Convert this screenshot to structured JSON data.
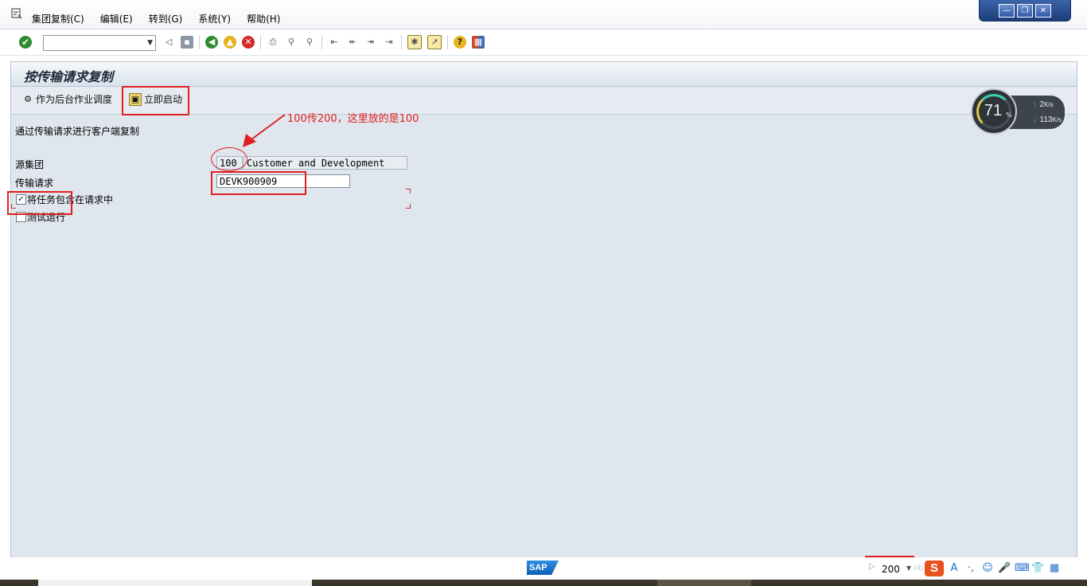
{
  "menu": {
    "items": [
      "集团复制(C)",
      "编辑(E)",
      "转到(G)",
      "系统(Y)",
      "帮助(H)"
    ]
  },
  "window_controls": {
    "minimize": "—",
    "restore": "❐",
    "close": "✕"
  },
  "toolbar": {
    "command_field_value": "",
    "icons": [
      "enter-icon",
      "back-arrow-icon",
      "save-icon",
      "back-icon",
      "exit-icon",
      "cancel-icon",
      "print-icon",
      "find-icon",
      "find-next-icon",
      "first-page-icon",
      "previous-page-icon",
      "next-page-icon",
      "last-page-icon",
      "create-session-icon",
      "shortcut-icon",
      "help-icon",
      "customize-layout-icon"
    ]
  },
  "screen": {
    "title": "按传输请求复制",
    "app_toolbar": {
      "background_schedule": "作为后台作业调度",
      "start_immediately": "立即启动"
    },
    "description": "通过传输请求进行客户端复制",
    "source_client": {
      "label": "源集团",
      "value": "100",
      "text": "Customer and Development"
    },
    "transport_request": {
      "label": "传输请求",
      "value": "DEVK900909"
    },
    "include_tasks": {
      "label": "将任务包含在请求中",
      "checked": true
    },
    "test_run": {
      "label": "测试运行",
      "checked": false
    }
  },
  "annotation": {
    "note": "100传200，这里放的是100"
  },
  "network_widget": {
    "percent": "71",
    "percent_sign": "%",
    "upload": "2",
    "download": "113",
    "unit": "K/s"
  },
  "statusbar": {
    "sap_logo": "SAP",
    "client": "200",
    "ime_logo": "S",
    "faint_text": "ob"
  },
  "colors": {
    "annotation": "#e02020",
    "sap_background": "#dfe6ee",
    "window_controls": "#1b3d7a"
  }
}
